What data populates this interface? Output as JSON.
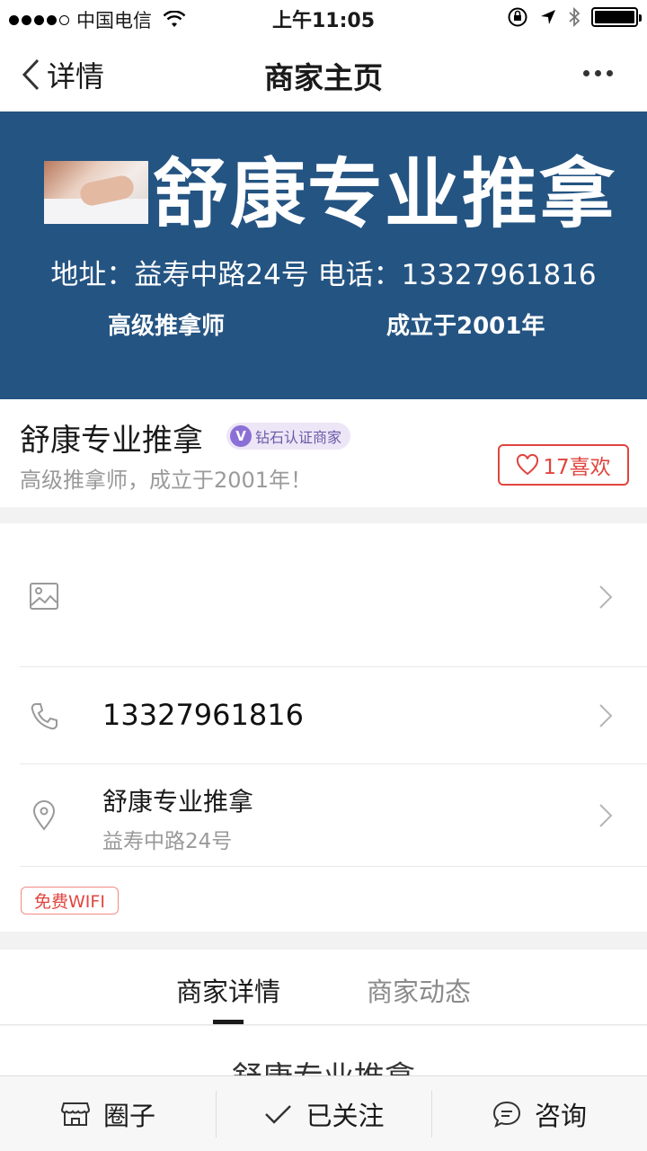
{
  "status_bar": {
    "carrier": "中国电信",
    "time": "上午11:05"
  },
  "nav": {
    "back_label": "详情",
    "title": "商家主页"
  },
  "banner": {
    "title": "舒康专业推拿",
    "address_phone": "地址：益寿中路24号  电话：13327961816",
    "tag_left": "高级推拿师",
    "tag_right": "成立于2001年"
  },
  "merchant": {
    "name": "舒康专业推拿",
    "badge_letter": "V",
    "badge_label": "钻石认证商家",
    "subtitle": "高级推拿师，成立于2001年！",
    "likes_label": "17喜欢"
  },
  "details": {
    "phone": "13327961816",
    "location_name": "舒康专业推拿",
    "location_address": "益寿中路24号",
    "wifi_tag": "免费WIFI"
  },
  "tabs": [
    {
      "label": "商家详情"
    },
    {
      "label": "商家动态"
    }
  ],
  "content": {
    "title": "舒康专业推拿"
  },
  "bottom_bar": {
    "circle_label": "圈子",
    "follow_label": "已关注",
    "consult_label": "咨询"
  },
  "colors": {
    "banner_bg": "#245482",
    "accent_red": "#e0453f",
    "badge_purple": "#8b6fd6"
  }
}
